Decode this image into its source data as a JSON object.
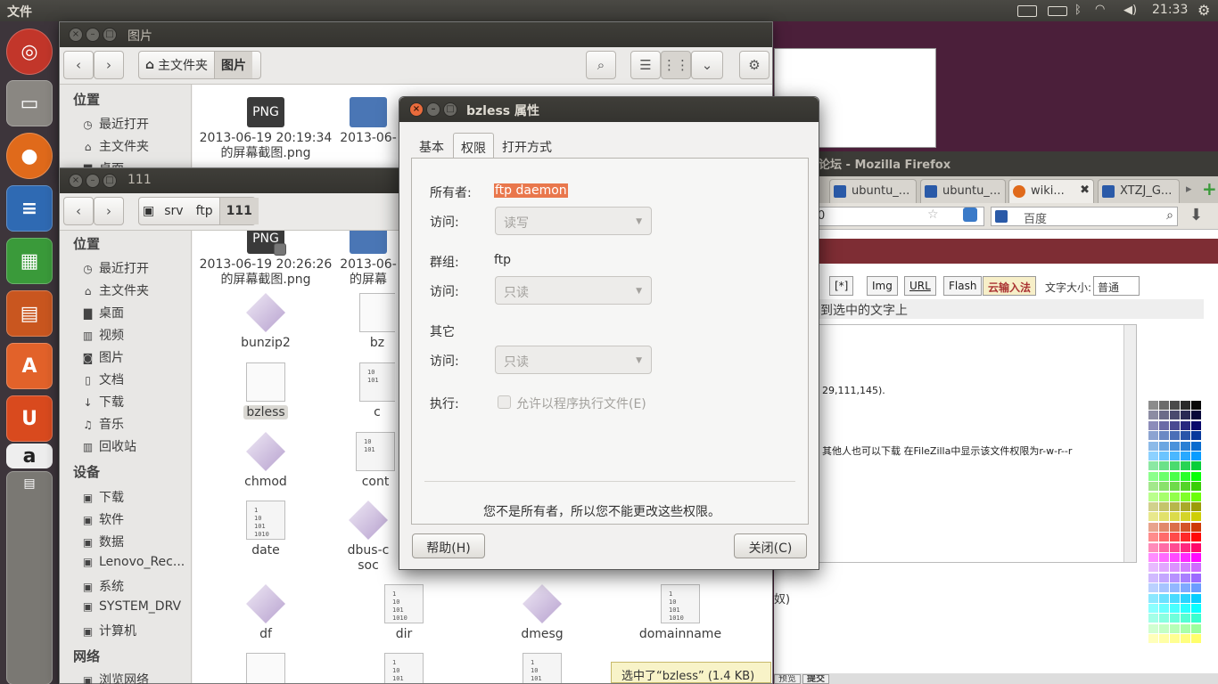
{
  "topbar": {
    "app_menu": "文件",
    "clock": "21:33",
    "indicators": [
      "keyboard-icon",
      "battery-icon",
      "bluetooth-icon",
      "wifi-icon",
      "volume-icon",
      "gear-icon"
    ]
  },
  "launcher": {
    "items": [
      "dash-home-icon",
      "files-icon",
      "firefox-icon",
      "writer-icon",
      "calc-icon",
      "impress-icon",
      "software-center-icon",
      "ubuntu-one-icon",
      "amazon-icon",
      "stacked-apps-icon"
    ]
  },
  "firefox": {
    "title": "论坛 - Mozilla Firefox",
    "tabs": [
      {
        "label": "ubuntu_..."
      },
      {
        "label": "ubuntu_..."
      },
      {
        "label": "wiki..."
      },
      {
        "label": "XTZJ_G..."
      }
    ],
    "address": "0",
    "search_placeholder": "百度",
    "editor_buttons": [
      "[*]",
      "Img",
      "URL",
      "Flash",
      "云输入法"
    ],
    "font_size_label": "文字大小:",
    "font_size_value": "普通",
    "hint": "到选中的文字上",
    "text1": "29,111,145).",
    "text2": "其他人也可以下载 在FileZilla中显示该文件权限为r-w-r--r",
    "text3": "奴)",
    "bottom_btns": [
      "预览",
      "提交"
    ]
  },
  "win_pictures": {
    "title": "图片",
    "crumbs": [
      "主文件夹",
      "图片"
    ],
    "sidebar_heading": "位置",
    "sidebar_items": [
      "最近打开",
      "主文件夹",
      "桌面"
    ],
    "files": [
      {
        "name": "2013-06-19 20:19:34 的屏幕截图.png",
        "line1": "2013-06-19 20:19:34",
        "line2": "的屏幕截图.png"
      },
      {
        "line1": "2013-06-",
        "line2": ""
      }
    ]
  },
  "win_111": {
    "title": "111",
    "crumbs": [
      "srv",
      "ftp",
      "111"
    ],
    "places_heading": "位置",
    "places": [
      {
        "icon": "clock-icon",
        "label": "最近打开"
      },
      {
        "icon": "home-icon",
        "label": "主文件夹"
      },
      {
        "icon": "folder-icon",
        "label": "桌面"
      },
      {
        "icon": "video-icon",
        "label": "视频"
      },
      {
        "icon": "camera-icon",
        "label": "图片"
      },
      {
        "icon": "document-icon",
        "label": "文档"
      },
      {
        "icon": "download-icon",
        "label": "下载"
      },
      {
        "icon": "music-icon",
        "label": "音乐"
      },
      {
        "icon": "trash-icon",
        "label": "回收站"
      }
    ],
    "devices_heading": "设备",
    "devices": [
      "下载",
      "软件",
      "数据",
      "Lenovo_Rec...",
      "系统",
      "SYSTEM_DRV",
      "计算机"
    ],
    "network_heading": "网络",
    "network": [
      "浏览网络"
    ],
    "files": [
      {
        "line1": "2013-06-19 20:26:26",
        "line2": "的屏幕截图.png",
        "type": "png"
      },
      {
        "line1": "2013-06-",
        "line2": "的屏幕",
        "type": "png"
      },
      {
        "line1": "bunzip2",
        "type": "script"
      },
      {
        "line1": "bz",
        "type": "txt"
      },
      {
        "line1": "bzless",
        "type": "txt",
        "selected": true
      },
      {
        "line1": "c",
        "type": "bin"
      },
      {
        "line1": "chmod",
        "type": "script"
      },
      {
        "line1": "cont",
        "type": "bin"
      },
      {
        "line1": "date",
        "type": "bin"
      },
      {
        "line1": "dbus-c",
        "line2": "soc",
        "type": "script"
      },
      {
        "line1": "df",
        "type": "script"
      },
      {
        "line1": "dir",
        "type": "bin"
      },
      {
        "line1": "dmesg",
        "type": "script"
      },
      {
        "line1": "domainname",
        "type": "bin"
      }
    ],
    "status": "选中了“bzless” (1.4 KB)"
  },
  "dialog": {
    "title": "bzless 属性",
    "tabs": [
      "基本",
      "权限",
      "打开方式"
    ],
    "owner_label": "所有者:",
    "owner_value": "ftp daemon",
    "access_label": "访问:",
    "owner_access": "读写",
    "group_label": "群组:",
    "group_value": "ftp",
    "group_access": "只读",
    "other_label": "其它",
    "other_access": "只读",
    "exec_label": "执行:",
    "exec_check": "允许以程序执行文件(E)",
    "notice": "您不是所有者，所以您不能更改这些权限。",
    "help_button": "帮助(H)",
    "close_button": "关闭(C)"
  }
}
